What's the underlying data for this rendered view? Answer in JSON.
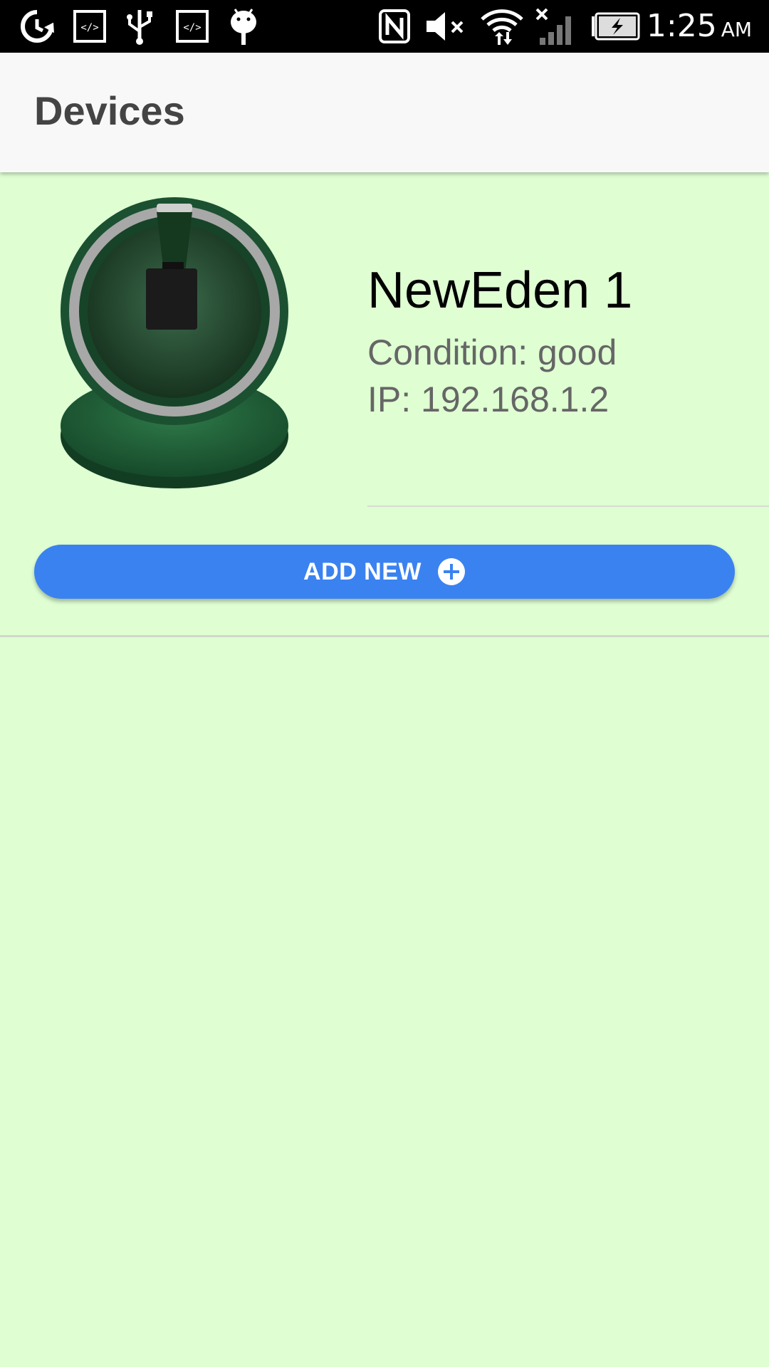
{
  "status_bar": {
    "time": "1:25",
    "ampm": "AM",
    "icons": [
      "sync-icon",
      "code-icon",
      "usb-icon",
      "code-icon",
      "android-debug-icon",
      "nfc-icon",
      "mute-icon",
      "wifi-icon",
      "no-signal-icon",
      "battery-charging-icon"
    ]
  },
  "app_bar": {
    "title": "Devices"
  },
  "devices": [
    {
      "name": "NewEden 1",
      "condition": "Condition: good",
      "ip": "IP: 192.168.1.2",
      "image_icon": "device-sphere-image"
    }
  ],
  "add_button": {
    "label": "ADD NEW",
    "icon": "plus-circle-icon"
  },
  "colors": {
    "background": "#dfffd3",
    "app_bar": "#f8f8f8",
    "accent": "#3b82f1",
    "device_green": "#1f5a34"
  }
}
